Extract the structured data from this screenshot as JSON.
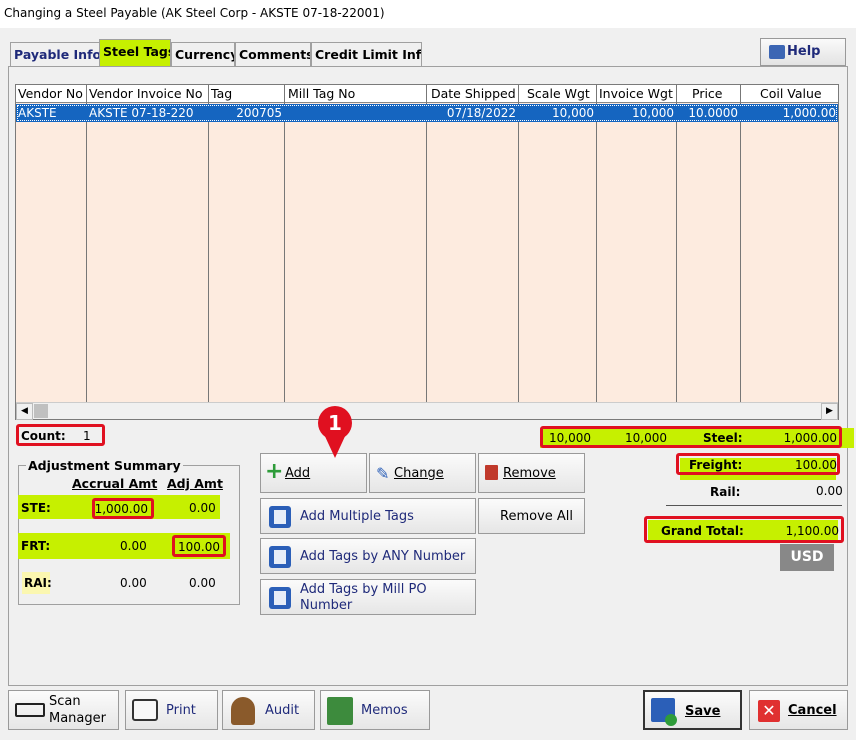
{
  "window": {
    "title": "Changing a Steel Payable  (AK Steel Corp - AKSTE 07-18-22001)"
  },
  "tabs": [
    {
      "label": "Payable Info"
    },
    {
      "label": "Steel Tags"
    },
    {
      "label": "Currency"
    },
    {
      "label": "Comments"
    },
    {
      "label": "Credit Limit Info"
    }
  ],
  "help": {
    "label": "Help"
  },
  "grid": {
    "columns": [
      "Vendor No",
      "Vendor Invoice No",
      "Tag",
      "Mill Tag No",
      "Date Shipped",
      "Scale Wgt",
      "Invoice Wgt",
      "Price",
      "Coil Value"
    ],
    "rows": [
      [
        "AKSTE",
        "AKSTE 07-18-220",
        "200705",
        "",
        "07/18/2022",
        "10,000",
        "10,000",
        "10.0000",
        "1,000.00"
      ]
    ]
  },
  "count": {
    "label": "Count:",
    "value": "1"
  },
  "totals": {
    "scale_total": "10,000",
    "invoice_total": "10,000",
    "steel_label": "Steel:",
    "steel_value": "1,000.00",
    "freight_label": "Freight:",
    "freight_value": "100.00",
    "rail_label": "Rail:",
    "rail_value": "0.00",
    "grand_label": "Grand Total:",
    "grand_value": "1,100.00",
    "currency": "USD"
  },
  "adjustment": {
    "title": "Adjustment Summary",
    "col_accrual": "Accrual Amt",
    "col_adj": "Adj Amt",
    "rows": [
      {
        "label": "STE:",
        "accrual": "1,000.00",
        "adj": "0.00"
      },
      {
        "label": "FRT:",
        "accrual": "0.00",
        "adj": "100.00"
      },
      {
        "label": "RAI:",
        "accrual": "0.00",
        "adj": "0.00"
      }
    ]
  },
  "actions": {
    "add": "Add",
    "change": "Change",
    "remove": "Remove",
    "add_multiple": "Add Multiple Tags",
    "remove_all": "Remove All",
    "add_any": "Add Tags by ANY Number",
    "add_mill_po_1": "Add Tags by Mill PO",
    "add_mill_po_2": "Number"
  },
  "callout": {
    "number": "1"
  },
  "bottom": {
    "scan_1": "Scan",
    "scan_2": "Manager",
    "print": "Print",
    "audit": "Audit",
    "memos": "Memos",
    "save": "Save",
    "cancel": "Cancel"
  }
}
